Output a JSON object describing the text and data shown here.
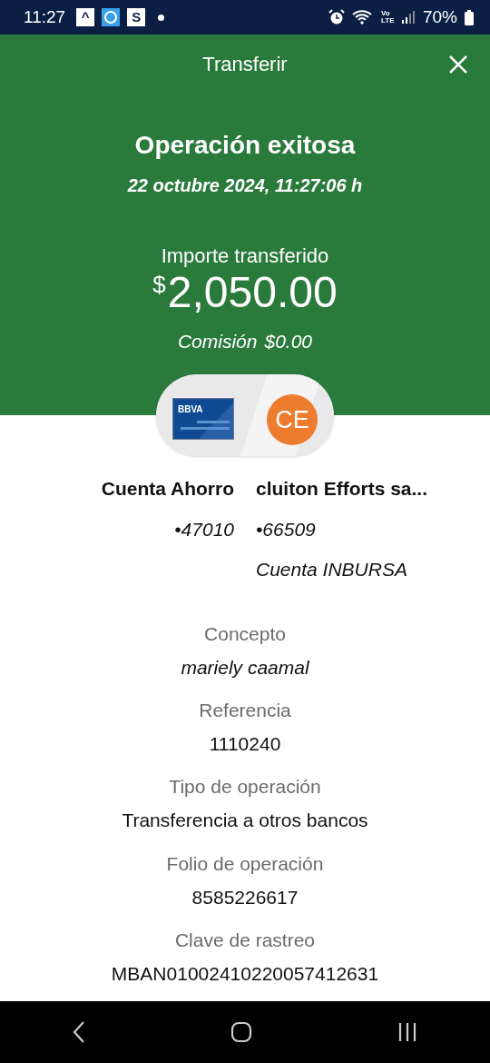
{
  "status_bar": {
    "time": "11:27",
    "notifications": [
      {
        "kind": "chat",
        "glyph": "^"
      },
      {
        "kind": "app"
      },
      {
        "kind": "letter",
        "glyph": "S"
      },
      {
        "kind": "dot"
      }
    ],
    "network": "Vo LTE",
    "battery": "70%"
  },
  "header": {
    "title": "Transferir"
  },
  "result": {
    "title": "Operación exitosa",
    "datetime": "22 octubre 2024, 11:27:06 h",
    "amount_label": "Importe transferido",
    "currency": "$",
    "amount": "2,050.00",
    "fee_label": "Comisión",
    "fee": "$0.00"
  },
  "origin": {
    "card_brand": "BBVA",
    "name": "Cuenta Ahorro",
    "number": "•47010"
  },
  "destination": {
    "initials": "CE",
    "name": "cluiton Efforts sa...",
    "number": "•66509",
    "bank": "Cuenta INBURSA"
  },
  "details": [
    {
      "label": "Concepto",
      "value": "mariely caamal",
      "italic": true
    },
    {
      "label": "Referencia",
      "value": "1110240",
      "italic": false
    },
    {
      "label": "Tipo de operación",
      "value": "Transferencia a otros bancos",
      "italic": false
    },
    {
      "label": "Folio de operación",
      "value": "8585226617",
      "italic": false
    },
    {
      "label": "Clave de rastreo",
      "value": "MBAN01002410220057412631",
      "italic": false
    }
  ]
}
